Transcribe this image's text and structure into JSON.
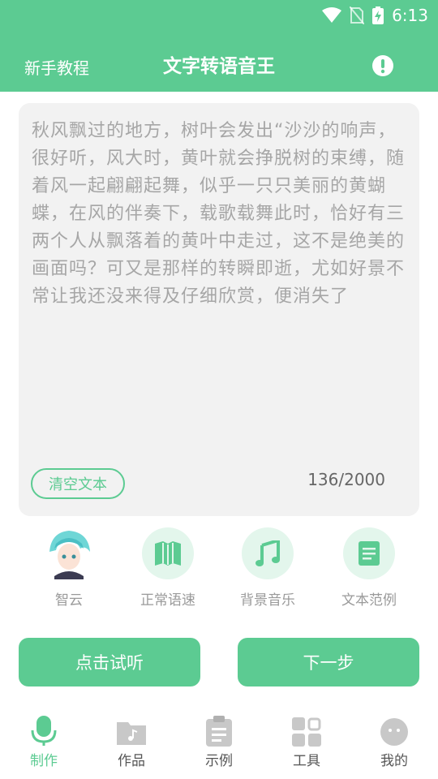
{
  "status_bar": {
    "time": "6:13"
  },
  "header": {
    "left_link": "新手教程",
    "title": "文字转语音王"
  },
  "editor": {
    "text": "秋风飘过的地方，树叶会发出“沙沙的响声，很好听，风大时，黄叶就会挣脱树的束缚，随着风一起翩翩起舞，似乎一只只美丽的黄蝴蝶，在风的伴奏下，载歌载舞此时，恰好有三两个人从飘落着的黄叶中走过，这不是绝美的画面吗？可又是那样的转瞬即逝，尤如好景不常让我还没来得及仔细欣赏，便消失了",
    "clear_label": "清空文本",
    "counter": "136/2000"
  },
  "options": [
    {
      "label": "智云",
      "icon": "voice-avatar"
    },
    {
      "label": "正常语速",
      "icon": "book-icon"
    },
    {
      "label": "背景音乐",
      "icon": "music-note-icon"
    },
    {
      "label": "文本范例",
      "icon": "document-icon"
    }
  ],
  "actions": {
    "preview": "点击试听",
    "next": "下一步"
  },
  "tabs": [
    {
      "label": "制作",
      "icon": "microphone-icon",
      "active": true
    },
    {
      "label": "作品",
      "icon": "folder-music-icon"
    },
    {
      "label": "示例",
      "icon": "clipboard-icon"
    },
    {
      "label": "工具",
      "icon": "grid-icon"
    },
    {
      "label": "我的",
      "icon": "face-icon"
    }
  ],
  "colors": {
    "accent": "#5ccb92",
    "accent_light": "#e3f6ec",
    "editor_bg": "#f2f2f2",
    "placeholder_text": "#a6a6a6"
  }
}
